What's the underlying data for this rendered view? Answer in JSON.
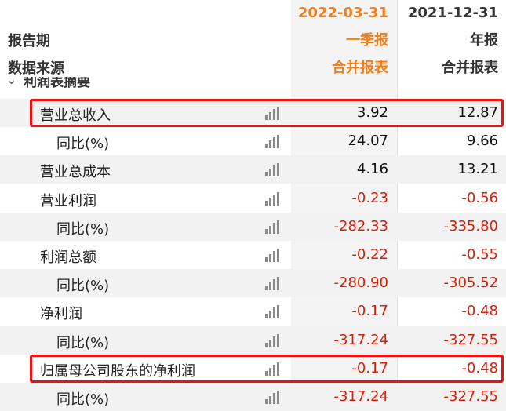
{
  "header": {
    "dates": [
      "2022-03-31",
      "2021-12-31"
    ],
    "report_period_label": "报告期",
    "report_periods": [
      "一季报",
      "年报"
    ],
    "data_source_label": "数据来源",
    "data_sources": [
      "合并报表",
      "合并报表"
    ]
  },
  "section": {
    "title": "利润表摘要",
    "expanded_icon": "chevron-down-icon"
  },
  "rows": [
    {
      "label": "营业总收入",
      "level": 1,
      "v1": "3.92",
      "v2": "12.87",
      "highlighted": true
    },
    {
      "label": "同比(%)",
      "level": 2,
      "v1": "24.07",
      "v2": "9.66"
    },
    {
      "label": "营业总成本",
      "level": 1,
      "v1": "4.16",
      "v2": "13.21"
    },
    {
      "label": "营业利润",
      "level": 1,
      "v1": "-0.23",
      "v2": "-0.56"
    },
    {
      "label": "同比(%)",
      "level": 2,
      "v1": "-282.33",
      "v2": "-335.80"
    },
    {
      "label": "利润总额",
      "level": 1,
      "v1": "-0.22",
      "v2": "-0.55"
    },
    {
      "label": "同比(%)",
      "level": 2,
      "v1": "-280.90",
      "v2": "-305.52"
    },
    {
      "label": "净利润",
      "level": 1,
      "v1": "-0.17",
      "v2": "-0.48"
    },
    {
      "label": "同比(%)",
      "level": 2,
      "v1": "-317.24",
      "v2": "-327.55"
    },
    {
      "label": "归属母公司股东的净利润",
      "level": 1,
      "v1": "-0.17",
      "v2": "-0.48",
      "highlighted": true
    },
    {
      "label": "同比(%)",
      "level": 2,
      "v1": "-317.24",
      "v2": "-327.55"
    }
  ],
  "colors": {
    "accent_orange": "#f07f1b",
    "negative_red": "#d81e06",
    "highlight_border": "#ee1111",
    "row_shade": "#f2f2f2"
  },
  "icons": {
    "chart_button": "bar-chart-icon"
  }
}
